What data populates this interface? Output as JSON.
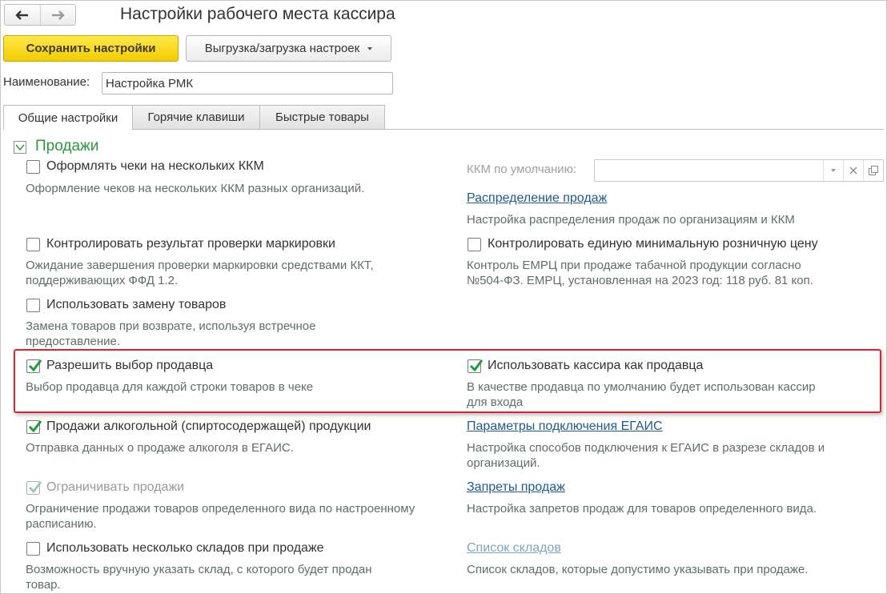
{
  "window": {
    "title": "Настройки рабочего места кассира"
  },
  "nav": {
    "back_icon": "arrow-left-icon",
    "forward_icon": "arrow-right-icon"
  },
  "toolbar": {
    "save_label": "Сохранить настройки",
    "export_label": "Выгрузка/загрузка настроек"
  },
  "name_field": {
    "label": "Наименование:",
    "value": "Настройка РМК"
  },
  "tabs": [
    {
      "label": "Общие настройки",
      "active": true
    },
    {
      "label": "Горячие клавиши",
      "active": false
    },
    {
      "label": "Быстрые товары",
      "active": false
    }
  ],
  "group": {
    "title": "Продажи",
    "expanded": true
  },
  "settings": {
    "multi_kkm": {
      "label": "Оформлять чеки на нескольких ККМ",
      "checked": false,
      "desc": "Оформление чеков на нескольких ККМ разных организаций."
    },
    "kkm_default": {
      "label": "ККМ по умолчанию:",
      "value": ""
    },
    "sales_distribution": {
      "link": "Распределение продаж",
      "desc": "Настройка распределения продаж по организациям и ККМ"
    },
    "marking_check": {
      "label": "Контролировать результат проверки маркировки",
      "checked": false,
      "desc_line1": "Ожидание завершения проверки маркировки средствами ККТ,",
      "desc_line2": "поддерживающих ФФД 1.2."
    },
    "min_price": {
      "label": "Контролировать единую минимальную розничную цену",
      "checked": false,
      "desc_line1": "Контроль ЕМРЦ при продаже табачной продукции согласно",
      "desc_line2": "№504-ФЗ. ЕМРЦ, установленная на 2023 год: 118 руб. 81 коп."
    },
    "replace_goods": {
      "label": "Использовать замену товаров",
      "checked": false,
      "desc_line1": "Замена товаров при возврате, используя встречное",
      "desc_line2": "предоставление."
    },
    "seller_choice": {
      "label": "Разрешить выбор продавца",
      "checked": true,
      "desc": "Выбор продавца для каждой строки товаров в чеке"
    },
    "cashier_as_seller": {
      "label": "Использовать кассира как продавца",
      "checked": true,
      "desc_line1": "В качестве продавца по умолчанию будет использован кассир",
      "desc_line2": "для входа"
    },
    "alcohol": {
      "label": "Продажи алкогольной (спиртосодержащей) продукции",
      "checked": true,
      "desc": "Отправка данных о продаже алкоголя в ЕГАИС."
    },
    "egais_params": {
      "link": "Параметры подключения ЕГАИС",
      "desc_line1": "Настройка способов подключения к ЕГАИС в разрезе складов и",
      "desc_line2": "организаций."
    },
    "limit_sales": {
      "label": "Ограничивать продажи",
      "checked": true,
      "disabled": true,
      "desc_line1": "Ограничение продажи товаров определенного вида по настроенному",
      "desc_line2": "расписанию."
    },
    "sales_bans": {
      "link": "Запреты продаж",
      "desc": "Настройка запретов продаж для товаров определенного вида."
    },
    "multi_warehouses": {
      "label": "Использовать несколько складов при продаже",
      "checked": false,
      "desc_line1": "Возможность вручную указать склад, с которого будет продан",
      "desc_line2": "товар."
    },
    "warehouse_list": {
      "link": "Список складов",
      "desc": "Список складов, которые допустимо указывать при продаже."
    }
  },
  "colors": {
    "accent_yellow": "#f5d000",
    "group_green": "#2a9a3a",
    "link_blue": "#1d5c8e",
    "highlight_red": "#e0232b",
    "check_green": "#1e9c3c"
  }
}
